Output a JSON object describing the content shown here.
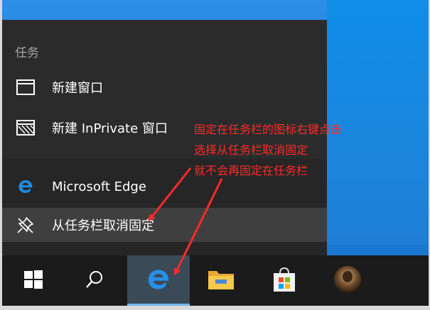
{
  "jumplist": {
    "section_header": "任务",
    "tasks": [
      {
        "label": "新建窗口",
        "icon": "window-icon"
      },
      {
        "label": "新建 InPrivate 窗口",
        "icon": "inprivate-window-icon"
      }
    ],
    "app": {
      "label": "Microsoft Edge",
      "icon": "edge-icon"
    },
    "unpin": {
      "label": "从任务栏取消固定",
      "icon": "unpin-icon"
    }
  },
  "annotation": {
    "lines": [
      "固定在任务栏的图标右键点击",
      "选择从任务栏取消固定",
      "就不会再固定在任务栏"
    ],
    "color": "#ff2a2a"
  },
  "taskbar": {
    "buttons": [
      {
        "name": "start-button",
        "icon": "windows-logo-icon"
      },
      {
        "name": "search-button",
        "icon": "search-icon"
      },
      {
        "name": "edge-taskbar-button",
        "icon": "edge-icon",
        "active": true
      },
      {
        "name": "file-explorer-button",
        "icon": "folder-icon"
      },
      {
        "name": "store-button",
        "icon": "store-bag-icon"
      },
      {
        "name": "user-app-button",
        "icon": "avatar-icon"
      }
    ]
  }
}
